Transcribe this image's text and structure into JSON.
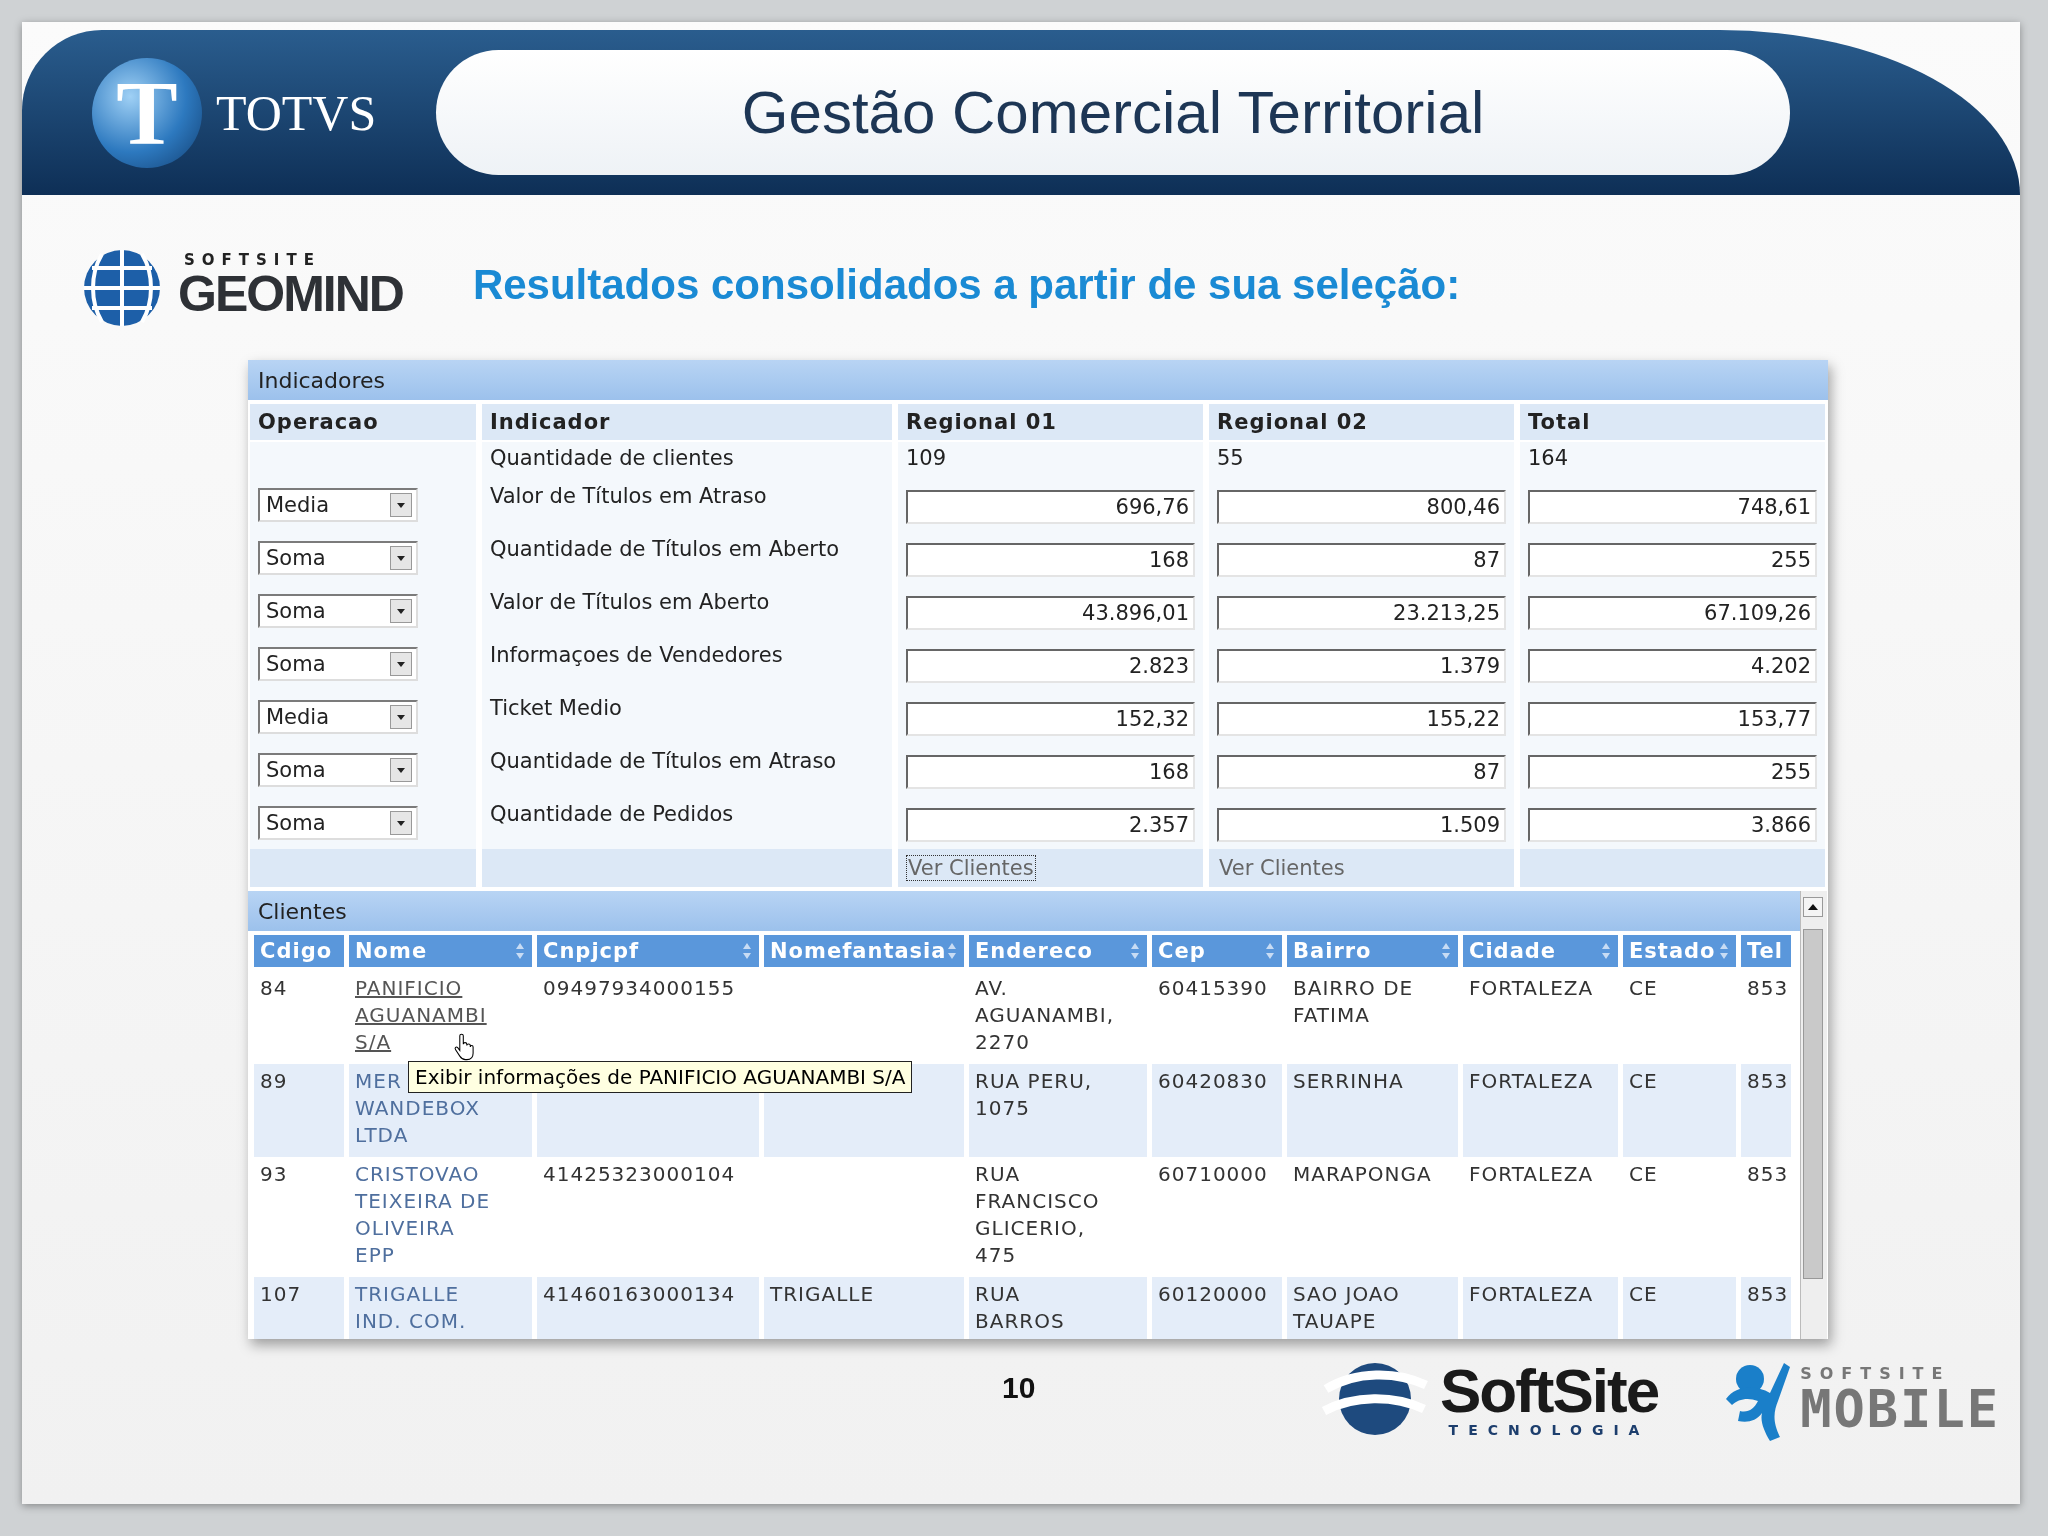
{
  "header": {
    "logo_letter": "T",
    "logo_text": "TOTVS",
    "title": "Gestão Comercial Territorial"
  },
  "brand": {
    "small": "SOFTSITE",
    "name": "GEOMIND"
  },
  "subtitle": "Resultados consolidados a partir de sua seleção:",
  "indicadores": {
    "title": "Indicadores",
    "columns": [
      "Operacao",
      "Indicador",
      "Regional 01",
      "Regional 02",
      "Total"
    ],
    "rows": [
      {
        "kind": "plain",
        "indicador": "Quantidade de clientes",
        "values": [
          "109",
          "55",
          "164"
        ]
      },
      {
        "kind": "input",
        "operacao": "Media",
        "indicador": "Valor de Títulos em Atraso",
        "values": [
          "696,76",
          "800,46",
          "748,61"
        ]
      },
      {
        "kind": "input",
        "operacao": "Soma",
        "indicador": "Quantidade de Títulos em Aberto",
        "values": [
          "168",
          "87",
          "255"
        ]
      },
      {
        "kind": "input",
        "operacao": "Soma",
        "indicador": "Valor de Títulos em Aberto",
        "values": [
          "43.896,01",
          "23.213,25",
          "67.109,26"
        ]
      },
      {
        "kind": "input",
        "operacao": "Soma",
        "indicador": "Informaçoes de Vendedores",
        "values": [
          "2.823",
          "1.379",
          "4.202"
        ]
      },
      {
        "kind": "input",
        "operacao": "Media",
        "indicador": "Ticket Medio",
        "values": [
          "152,32",
          "155,22",
          "153,77"
        ]
      },
      {
        "kind": "input",
        "operacao": "Soma",
        "indicador": "Quantidade de Títulos em Atraso",
        "values": [
          "168",
          "87",
          "255"
        ]
      },
      {
        "kind": "input",
        "operacao": "Soma",
        "indicador": "Quantidade de Pedidos",
        "values": [
          "2.357",
          "1.509",
          "3.866"
        ]
      }
    ],
    "links": [
      {
        "label": "Ver Clientes",
        "focused": true
      },
      {
        "label": "Ver Clientes",
        "focused": false
      }
    ]
  },
  "clientes": {
    "title": "Clientes",
    "columns": [
      "Cdigo",
      "Nome",
      "Cnpjcpf",
      "Nomefantasia",
      "Endereco",
      "Cep",
      "Bairro",
      "Cidade",
      "Estado",
      "Tel"
    ],
    "rows": [
      {
        "hovered": true,
        "cells": [
          "84",
          "PANIFICIO\nAGUANAMBI\nS/A",
          "09497934000155",
          "",
          "AV.\nAGUANAMBI,\n2270",
          "60415390",
          "BAIRRO DE\nFATIMA",
          "FORTALEZA",
          "CE",
          "853"
        ]
      },
      {
        "hovered": false,
        "cells": [
          "89",
          "MER\nWANDEBOX\nLTDA",
          "",
          "",
          "RUA PERU,\n1075",
          "60420830",
          "SERRINHA",
          "FORTALEZA",
          "CE",
          "853"
        ]
      },
      {
        "hovered": false,
        "cells": [
          "93",
          "CRISTOVAO\nTEIXEIRA DE\nOLIVEIRA\nEPP",
          "41425323000104",
          "",
          "RUA\nFRANCISCO\nGLICERIO,\n475",
          "60710000",
          "MARAPONGA",
          "FORTALEZA",
          "CE",
          "853"
        ]
      },
      {
        "hovered": false,
        "cells": [
          "107",
          "TRIGALLE\nIND. COM.",
          "41460163000134",
          "TRIGALLE",
          "RUA\nBARROS",
          "60120000",
          "SAO JOAO\nTAUAPE",
          "FORTALEZA",
          "CE",
          "853"
        ]
      }
    ],
    "tooltip": "Exibir informações de PANIFICIO AGUANAMBI S/A"
  },
  "footer": {
    "page": "10",
    "softsite": "SoftSite",
    "softsite_sub": "TECNOLOGIA",
    "mobile_small": "SOFTSITE",
    "mobile": "MOBILE"
  }
}
